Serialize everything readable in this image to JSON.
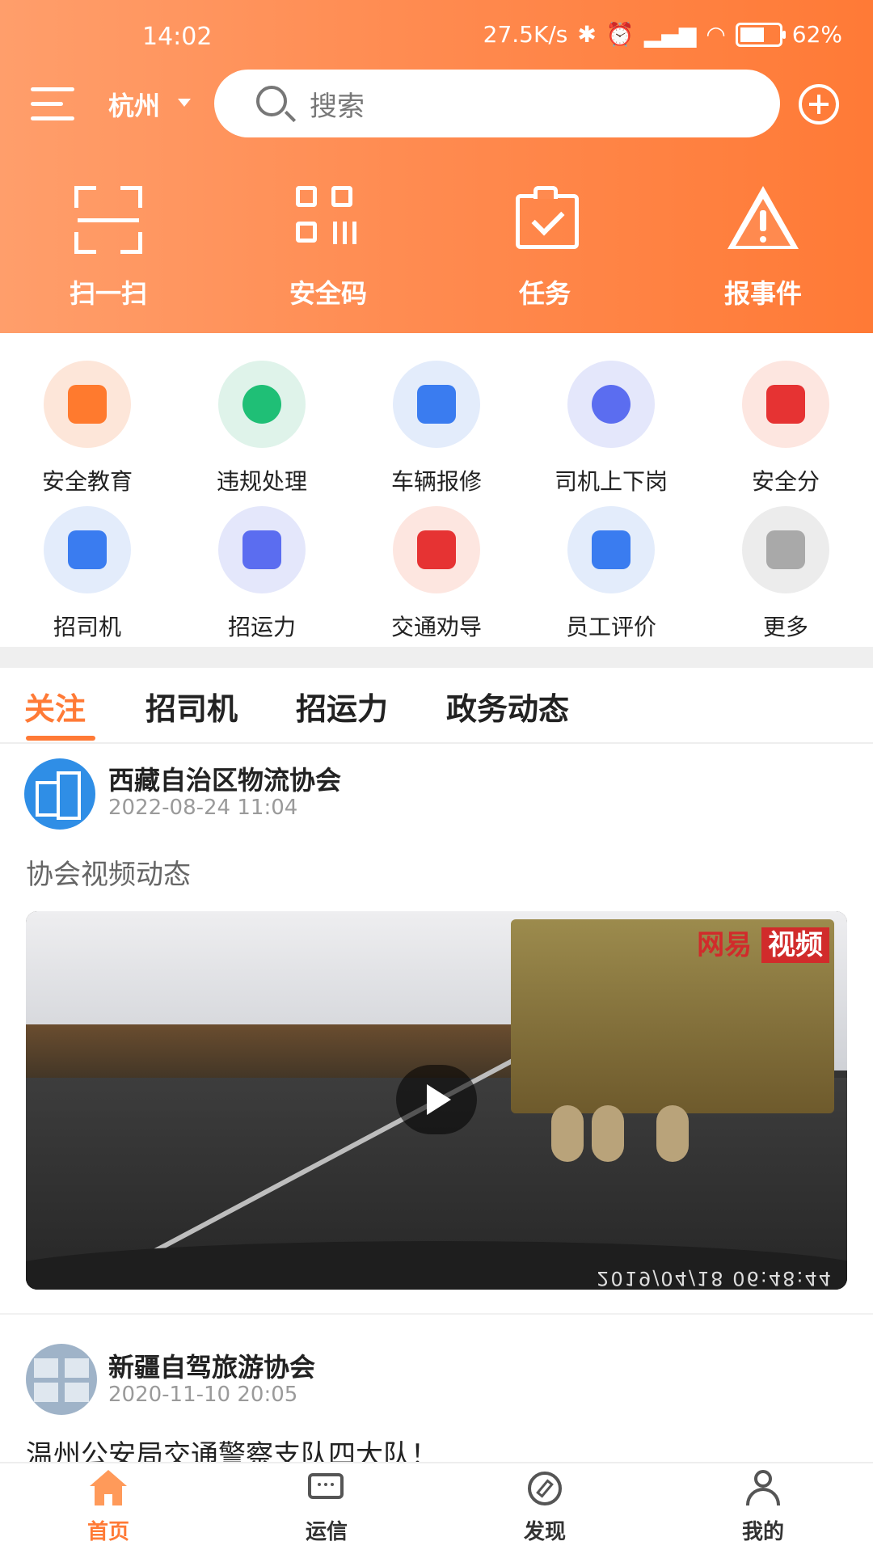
{
  "status_bar": {
    "time": "14:02",
    "net_speed": "27.5K/s",
    "battery": "62%",
    "battery_level": 0.62
  },
  "header": {
    "city": "杭州",
    "search_placeholder": "搜索",
    "quick_actions": [
      {
        "label": "扫一扫",
        "icon": "scan-icon"
      },
      {
        "label": "安全码",
        "icon": "qr-code-icon"
      },
      {
        "label": "任务",
        "icon": "task-icon"
      },
      {
        "label": "报事件",
        "icon": "warning-icon"
      }
    ]
  },
  "services": [
    {
      "label": "安全教育",
      "icon": "graduation-cap-icon",
      "bg": "#fde6d9",
      "fg": "#ff7a2e"
    },
    {
      "label": "违规处理",
      "icon": "check-icon",
      "bg": "#dff3ea",
      "fg": "#1fbf76"
    },
    {
      "label": "车辆报修",
      "icon": "shield-plus-icon",
      "bg": "#e3ecfb",
      "fg": "#3a7cf0"
    },
    {
      "label": "司机上下岗",
      "icon": "driver-icon",
      "bg": "#e4e7fb",
      "fg": "#5b6df0"
    },
    {
      "label": "安全分",
      "icon": "star-icon",
      "bg": "#fde6e0",
      "fg": "#e63333"
    },
    {
      "label": "招司机",
      "icon": "recruit-driver-icon",
      "bg": "#e3ecfb",
      "fg": "#3a7cf0"
    },
    {
      "label": "招运力",
      "icon": "truck-icon",
      "bg": "#e4e7fb",
      "fg": "#5b6df0"
    },
    {
      "label": "交通劝导",
      "icon": "traffic-light-icon",
      "bg": "#fde6e0",
      "fg": "#e63333"
    },
    {
      "label": "员工评价",
      "icon": "edit-icon",
      "bg": "#e3ecfb",
      "fg": "#3a7cf0"
    },
    {
      "label": "更多",
      "icon": "more-grid-icon",
      "bg": "#ececec",
      "fg": "#a9a9a9"
    }
  ],
  "tabs": [
    "关注",
    "招司机",
    "招运力",
    "政务动态"
  ],
  "feed": [
    {
      "author": "西藏自治区物流协会",
      "date": "2022-08-24 11:04",
      "title": "协会视频动态",
      "watermark_a": "网易",
      "watermark_b": "视频",
      "video_timestamp": "2019/04/18 06:48:44"
    },
    {
      "author": "新疆自驾旅游协会",
      "date": "2020-11-10 20:05",
      "title": "温州公安局交通警察支队四大队！"
    }
  ],
  "bottom_nav": [
    {
      "label": "首页",
      "icon": "home-icon",
      "active": true
    },
    {
      "label": "运信",
      "icon": "message-icon",
      "active": false
    },
    {
      "label": "发现",
      "icon": "compass-icon",
      "active": false
    },
    {
      "label": "我的",
      "icon": "profile-icon",
      "active": false
    }
  ],
  "colors": {
    "accent": "#ff7a36"
  }
}
